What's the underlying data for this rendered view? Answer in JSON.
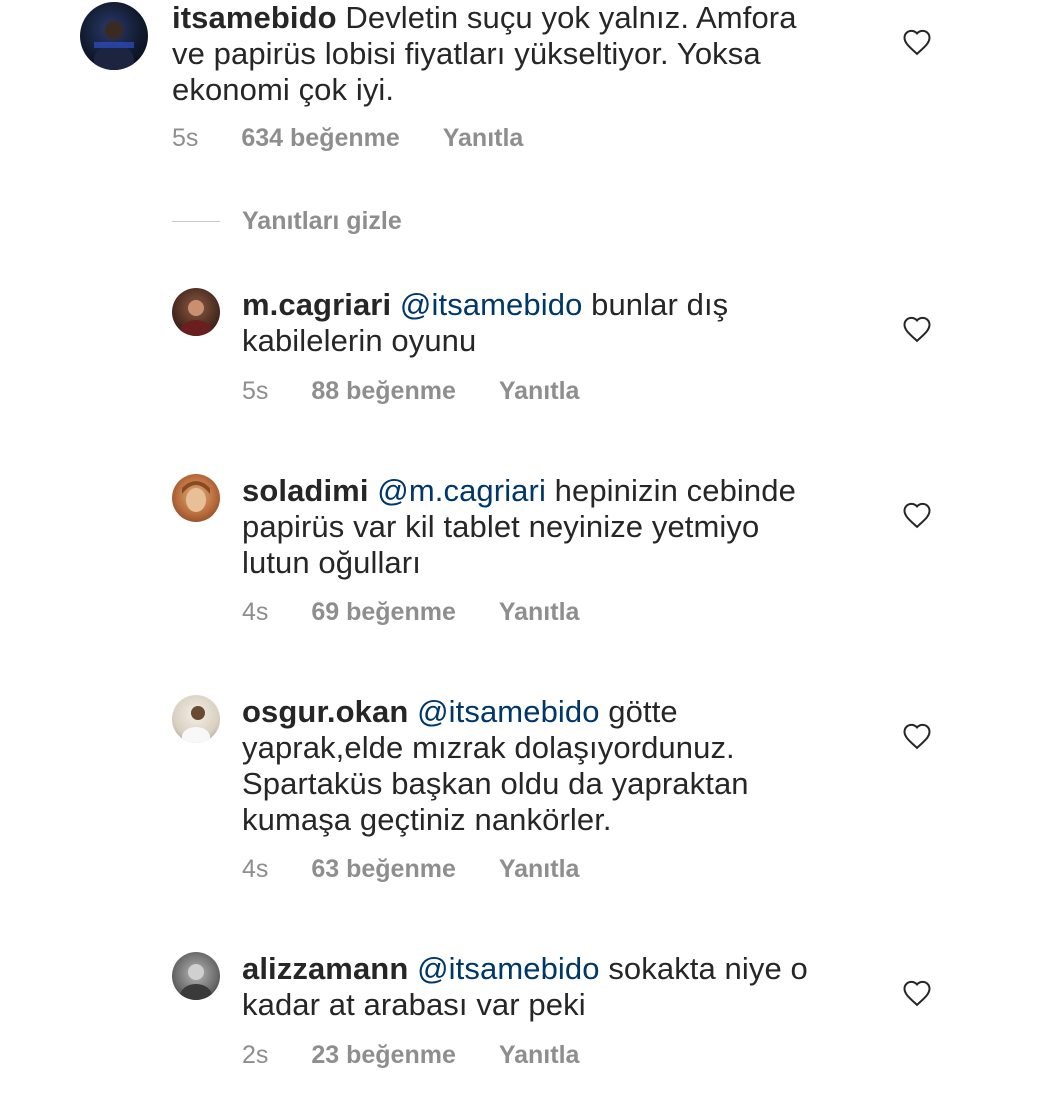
{
  "comments": [
    {
      "username": "itsamebido",
      "mention": "",
      "text": "Devletin suçu yok yalnız. Amfora ve papirüs lobisi fiyatları yükseltiyor. Yoksa ekonomi çok iyi.",
      "time": "5s",
      "likes": "634 beğenme",
      "reply": "Yanıtla"
    },
    {
      "username": "m.cagriari",
      "mention": "@itsamebido",
      "text": "bunlar dış kabilelerin oyunu",
      "time": "5s",
      "likes": "88 beğenme",
      "reply": "Yanıtla"
    },
    {
      "username": "soladimi",
      "mention": "@m.cagriari",
      "text": "hepinizin cebinde papirüs var kil tablet neyinize yetmiyo lutun oğulları",
      "time": "4s",
      "likes": "69 beğenme",
      "reply": "Yanıtla"
    },
    {
      "username": "osgur.okan",
      "mention": "@itsamebido",
      "text": "götte yaprak,elde mızrak dolaşıyordunuz. Spartaküs başkan oldu da yapraktan kumaşa geçtiniz nankörler.",
      "time": "4s",
      "likes": "63 beğenme",
      "reply": "Yanıtla"
    },
    {
      "username": "alizzamann",
      "mention": "@itsamebido",
      "text": "sokakta niye o kadar at arabası var peki",
      "time": "2s",
      "likes": "23 beğenme",
      "reply": "Yanıtla"
    }
  ],
  "hide_replies_label": "Yanıtları gizle",
  "icons": {
    "like": "heart-outline-icon"
  },
  "colors": {
    "text": "#262626",
    "mention": "#00376b",
    "meta": "#8e8e8e"
  }
}
